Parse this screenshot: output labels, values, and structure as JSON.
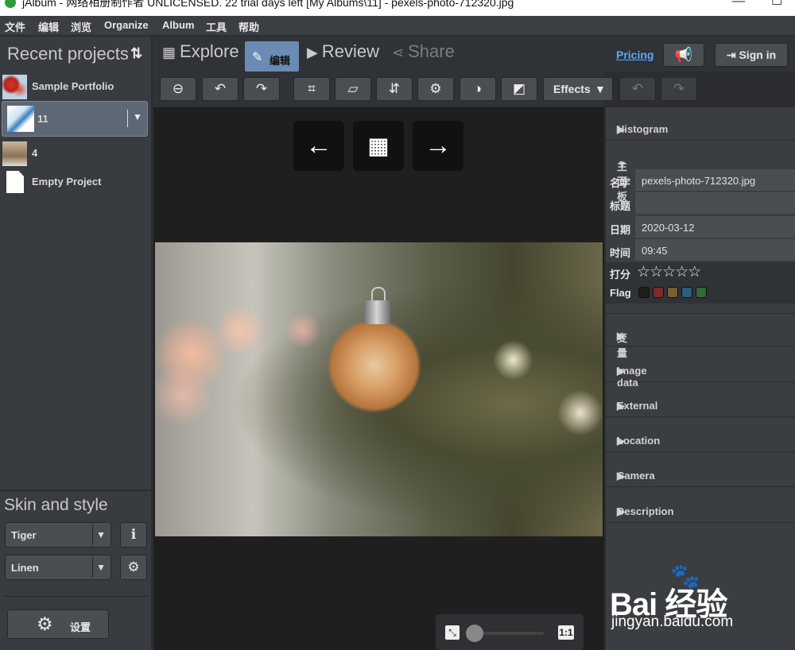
{
  "window": {
    "title": "jAlbum - 网络相册制作者 UNLICENSED. 22 trial days left [My Albums\\11] - pexels-photo-712320.jpg"
  },
  "menu": [
    "文件",
    "编辑",
    "浏览",
    "Organize",
    "Album",
    "工具",
    "帮助"
  ],
  "left_panel": {
    "recent_title": "Recent projects",
    "projects": [
      {
        "name": "Sample Portfolio"
      },
      {
        "name": "11",
        "selected": true
      },
      {
        "name": "4"
      },
      {
        "name": "Empty Project"
      }
    ],
    "skin_title": "Skin and style",
    "skin_value": "Tiger",
    "style_value": "Linen",
    "settings_label": "设置"
  },
  "tabs": {
    "explore": "Explore",
    "edit": "编辑",
    "review": "Review",
    "share": "Share"
  },
  "topright": {
    "pricing": "Pricing",
    "signin": "Sign in"
  },
  "toolbar": {
    "effects": "Effects"
  },
  "viewer": {
    "zoom_fit": "⤡",
    "zoom_1to1": "1:1"
  },
  "right_panel": {
    "sections_top": [
      "Histogram",
      "主面板"
    ],
    "props": [
      {
        "key": "名字",
        "value": "pexels-photo-712320.jpg"
      },
      {
        "key": "标题",
        "value": ""
      },
      {
        "key": "日期",
        "value": "2020-03-12"
      },
      {
        "key": "时间",
        "value": "09:45"
      }
    ],
    "rating_label": "打分",
    "flag_label": "Flag",
    "flag_colors": [
      "#1e1e1e",
      "#7a2c2c",
      "#7a5e30",
      "#2e5d7a",
      "#2f6b36"
    ],
    "sections_bottom": [
      "变量",
      "Image data",
      "External",
      "Location",
      "Camera",
      "Description"
    ]
  },
  "watermark": {
    "brand": "Bai 经验",
    "url": "jingyan.baidu.com"
  }
}
